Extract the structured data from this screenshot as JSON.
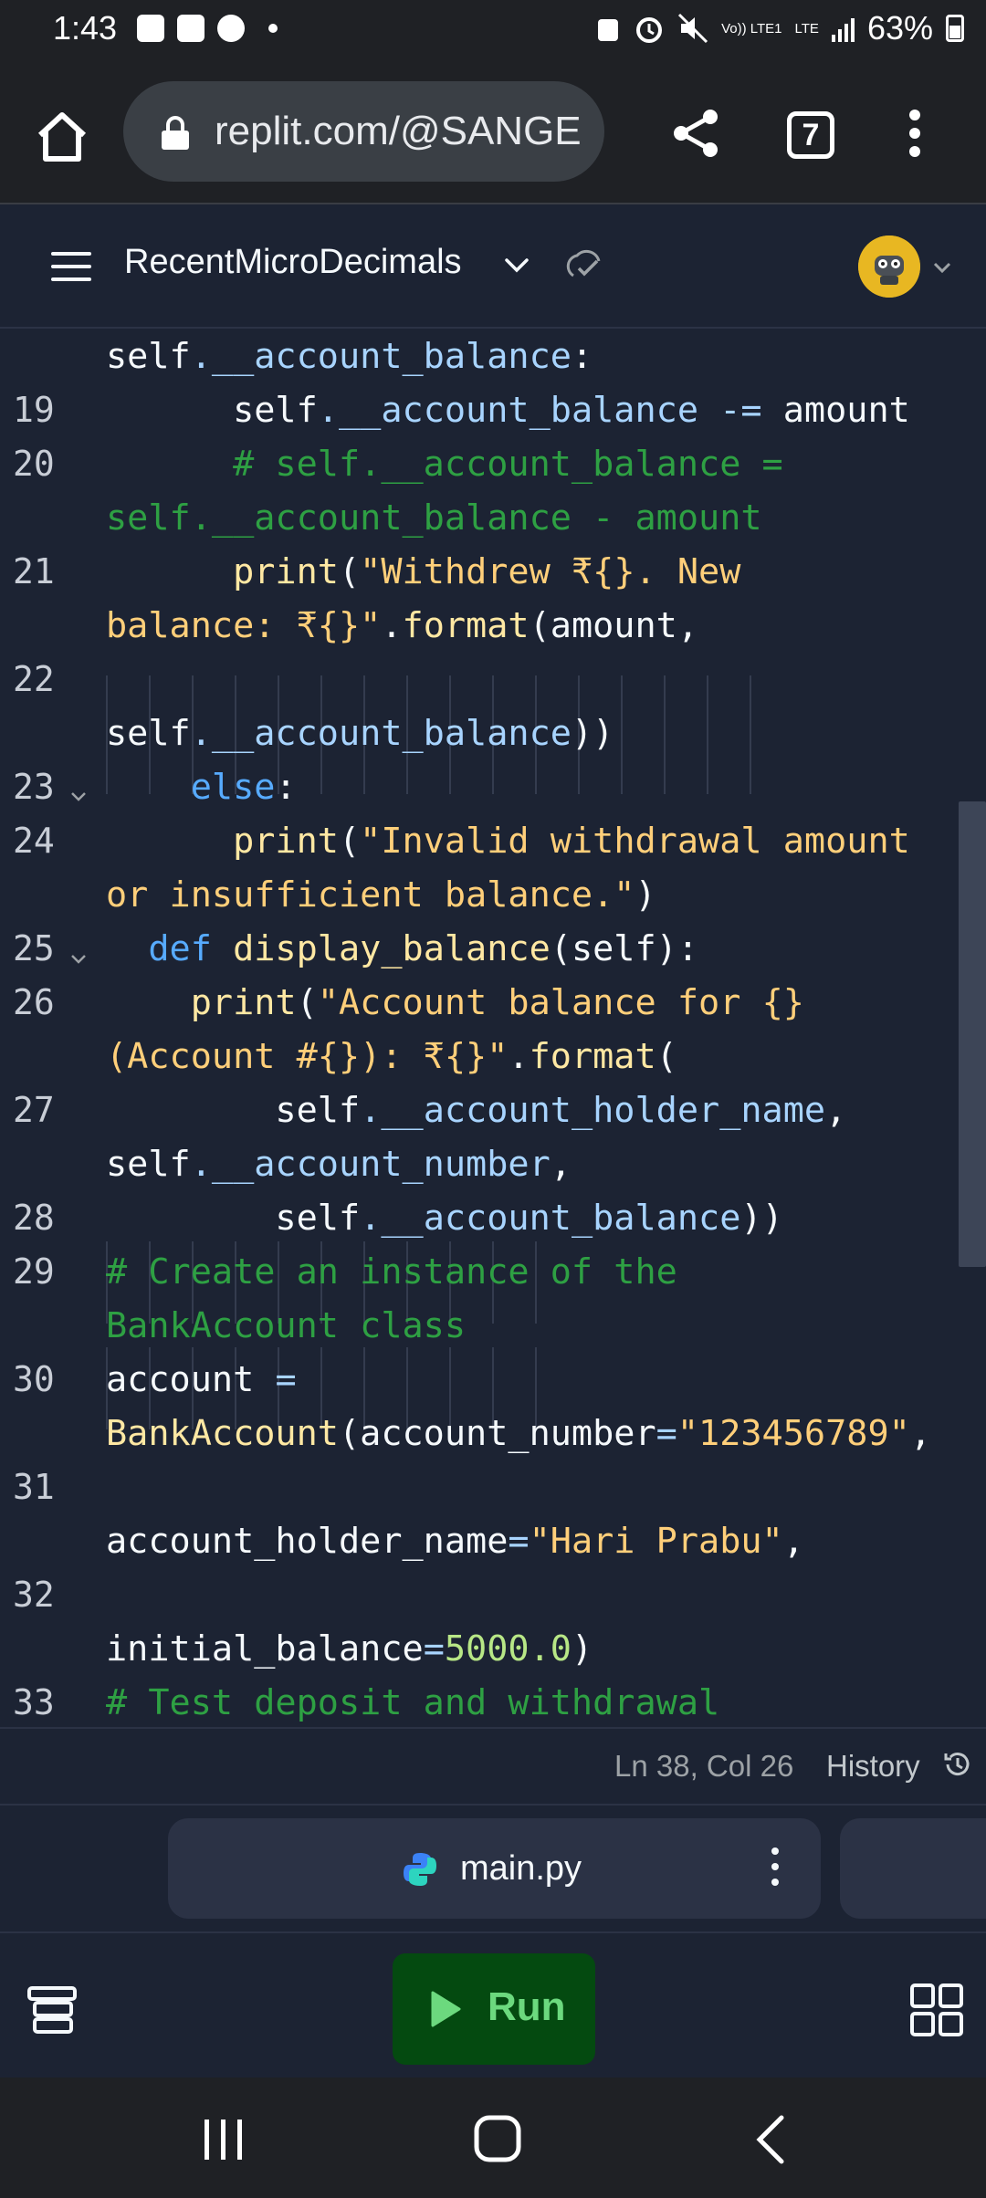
{
  "status_bar": {
    "time": "1:43",
    "network": "Vo)) LTE1",
    "lte": "LTE",
    "battery": "63%"
  },
  "browser": {
    "url": "replit.com/@SANGE",
    "tab_count": "7"
  },
  "header": {
    "project_name": "RecentMicroDecimals"
  },
  "editor": {
    "line_numbers": [
      "19",
      "20",
      "21",
      "22",
      "23",
      "24",
      "25",
      "26",
      "27",
      "28",
      "29",
      "30",
      "31",
      "32",
      "33"
    ],
    "lines": [
      {
        "parts": [
          {
            "t": "self",
            "c": ""
          },
          {
            "t": ".__account_balance",
            "c": "c-blue"
          },
          {
            "t": ":",
            "c": ""
          }
        ]
      },
      {
        "parts": [
          {
            "t": "      self",
            "c": ""
          },
          {
            "t": ".__account_balance ",
            "c": "c-blue"
          },
          {
            "t": "-=",
            "c": "c-op"
          },
          {
            "t": " amount",
            "c": ""
          }
        ]
      },
      {
        "parts": [
          {
            "t": "      # self.__account_balance =",
            "c": "c-cmt"
          }
        ]
      },
      {
        "parts": [
          {
            "t": "self.__account_balance - amount",
            "c": "c-cmt"
          }
        ]
      },
      {
        "parts": [
          {
            "t": "      ",
            "c": ""
          },
          {
            "t": "print",
            "c": "c-fn"
          },
          {
            "t": "(",
            "c": ""
          },
          {
            "t": "\"Withdrew ₹{}. New",
            "c": "c-str"
          }
        ]
      },
      {
        "parts": [
          {
            "t": "balance: ₹{}\"",
            "c": "c-str"
          },
          {
            "t": ".",
            "c": ""
          },
          {
            "t": "format",
            "c": "c-fn"
          },
          {
            "t": "(amount,",
            "c": ""
          }
        ]
      },
      {
        "parts": [
          {
            "t": "",
            "c": ""
          }
        ]
      },
      {
        "parts": [
          {
            "t": "self",
            "c": ""
          },
          {
            "t": ".__account_balance",
            "c": "c-blue"
          },
          {
            "t": "))",
            "c": ""
          }
        ]
      },
      {
        "parts": [
          {
            "t": "    ",
            "c": ""
          },
          {
            "t": "else",
            "c": "c-kw"
          },
          {
            "t": ":",
            "c": ""
          }
        ]
      },
      {
        "parts": [
          {
            "t": "      ",
            "c": ""
          },
          {
            "t": "print",
            "c": "c-fn"
          },
          {
            "t": "(",
            "c": ""
          },
          {
            "t": "\"Invalid withdrawal amount",
            "c": "c-str"
          }
        ]
      },
      {
        "parts": [
          {
            "t": "or insufficient balance.\"",
            "c": "c-str"
          },
          {
            "t": ")",
            "c": ""
          }
        ]
      },
      {
        "parts": [
          {
            "t": "  ",
            "c": ""
          },
          {
            "t": "def ",
            "c": "c-kw"
          },
          {
            "t": "display_balance",
            "c": "c-fn"
          },
          {
            "t": "(self):",
            "c": ""
          }
        ]
      },
      {
        "parts": [
          {
            "t": "    ",
            "c": ""
          },
          {
            "t": "print",
            "c": "c-fn"
          },
          {
            "t": "(",
            "c": ""
          },
          {
            "t": "\"Account balance for {}",
            "c": "c-str"
          }
        ]
      },
      {
        "parts": [
          {
            "t": "(Account #{}): ₹{}\"",
            "c": "c-str"
          },
          {
            "t": ".",
            "c": ""
          },
          {
            "t": "format",
            "c": "c-fn"
          },
          {
            "t": "(",
            "c": ""
          }
        ]
      },
      {
        "parts": [
          {
            "t": "        self",
            "c": ""
          },
          {
            "t": ".__account_holder_name",
            "c": "c-blue"
          },
          {
            "t": ",",
            "c": ""
          }
        ]
      },
      {
        "parts": [
          {
            "t": "self",
            "c": ""
          },
          {
            "t": ".__account_number",
            "c": "c-blue"
          },
          {
            "t": ",",
            "c": ""
          }
        ]
      },
      {
        "parts": [
          {
            "t": "        self",
            "c": ""
          },
          {
            "t": ".__account_balance",
            "c": "c-blue"
          },
          {
            "t": "))",
            "c": ""
          }
        ]
      },
      {
        "parts": [
          {
            "t": "# Create an instance of the",
            "c": "c-cmt"
          }
        ]
      },
      {
        "parts": [
          {
            "t": "BankAccount class",
            "c": "c-cmt"
          }
        ]
      },
      {
        "parts": [
          {
            "t": "account ",
            "c": ""
          },
          {
            "t": "=",
            "c": "c-op"
          }
        ]
      },
      {
        "parts": [
          {
            "t": "BankAccount",
            "c": "c-fn"
          },
          {
            "t": "(account_number",
            "c": ""
          },
          {
            "t": "=",
            "c": "c-op"
          },
          {
            "t": "\"123456789\"",
            "c": "c-str"
          },
          {
            "t": ",",
            "c": ""
          }
        ]
      },
      {
        "parts": [
          {
            "t": "",
            "c": ""
          }
        ]
      },
      {
        "parts": [
          {
            "t": "account_holder_name",
            "c": ""
          },
          {
            "t": "=",
            "c": "c-op"
          },
          {
            "t": "\"Hari Prabu\"",
            "c": "c-str"
          },
          {
            "t": ",",
            "c": ""
          }
        ]
      },
      {
        "parts": [
          {
            "t": "",
            "c": ""
          }
        ]
      },
      {
        "parts": [
          {
            "t": "initial_balance",
            "c": ""
          },
          {
            "t": "=",
            "c": "c-op"
          },
          {
            "t": "5000.0",
            "c": "c-num"
          },
          {
            "t": ")",
            "c": ""
          }
        ]
      },
      {
        "parts": [
          {
            "t": "# Test deposit and withdrawal",
            "c": "c-cmt"
          }
        ]
      }
    ]
  },
  "editor_status": {
    "cursor": "Ln 38, Col 26",
    "history_label": "History"
  },
  "file_tab": {
    "name": "main.py"
  },
  "toolbar": {
    "run_label": "Run"
  },
  "colors": {
    "background": "#1c2333",
    "run_bg": "#044a10",
    "run_text": "#6cd97e",
    "comment": "#2ea043",
    "string": "#ffcf7a",
    "keyword": "#57abff"
  },
  "icons": [
    "home-icon",
    "lock-icon",
    "share-icon",
    "tabs-icon",
    "more-vert-icon",
    "hamburger-icon",
    "chevron-down-icon",
    "sync-check-icon",
    "avatar",
    "history-icon",
    "python-icon",
    "more-vert-icon",
    "tools-icon",
    "play-icon",
    "grid-icon",
    "recents-icon",
    "home-nav-icon",
    "back-icon"
  ]
}
